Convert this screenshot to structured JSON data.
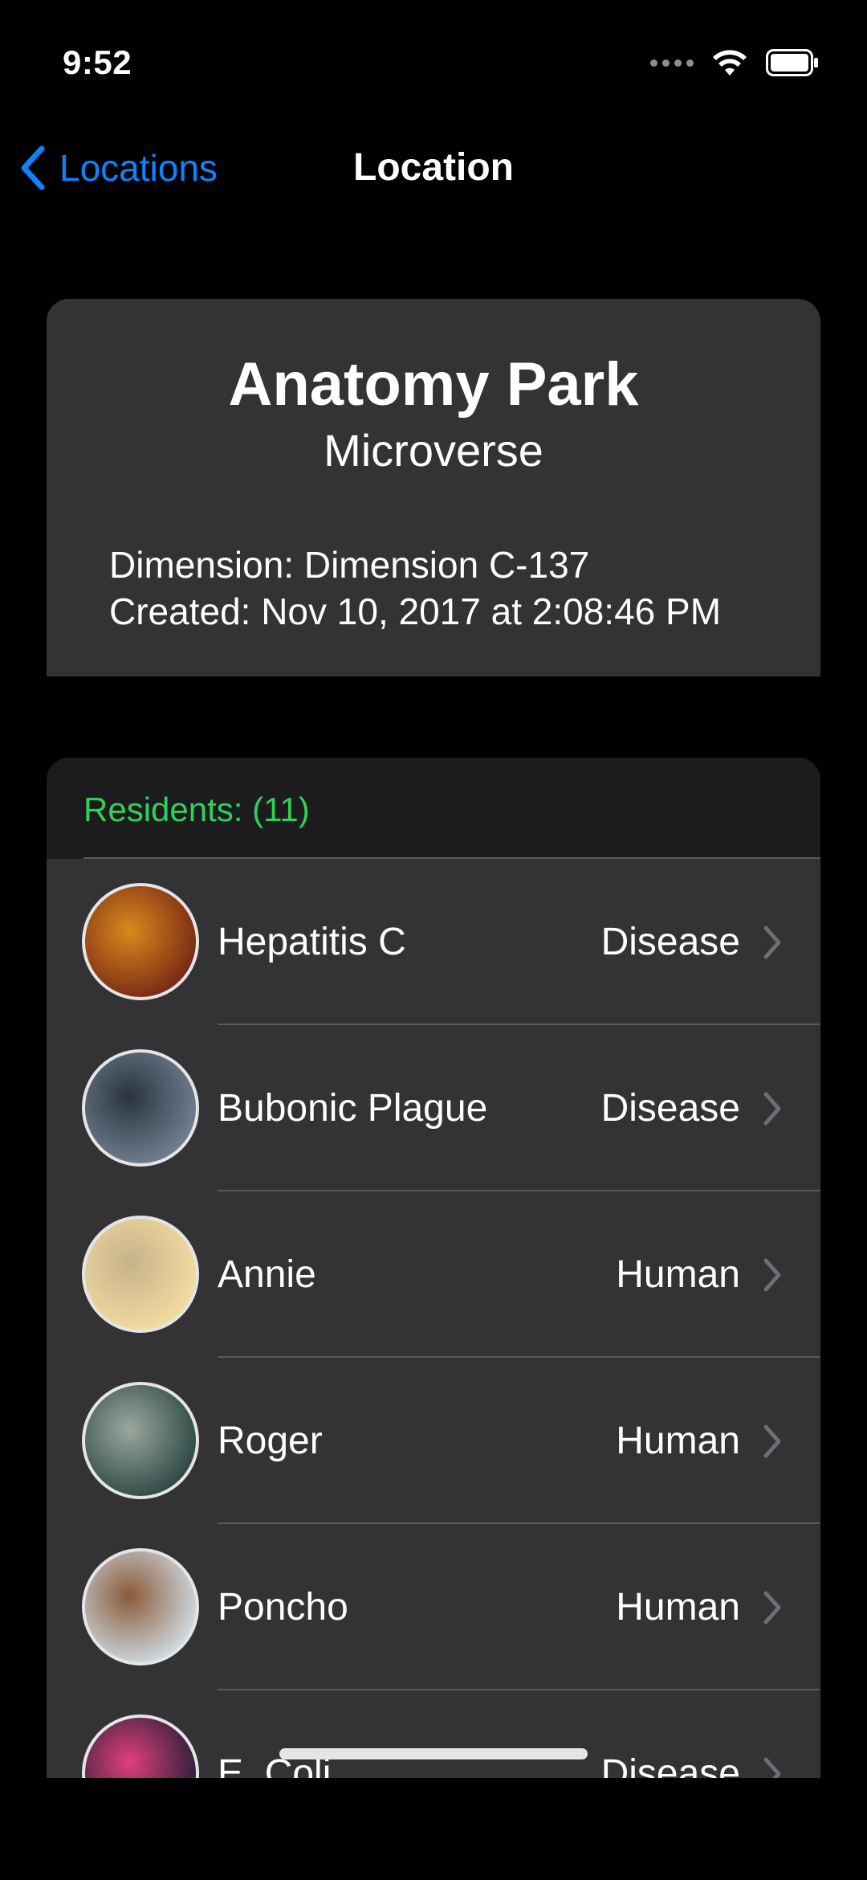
{
  "status_bar": {
    "time": "9:52"
  },
  "nav": {
    "back_label": "Locations",
    "title": "Location"
  },
  "location": {
    "name": "Anatomy Park",
    "type": "Microverse",
    "dimension": "Dimension: Dimension C-137",
    "created": "Created: Nov 10, 2017 at 2:08:46 PM"
  },
  "residents": {
    "header": "Residents: (11)",
    "items": [
      {
        "name": "Hepatitis C",
        "species": "Disease",
        "avatar_colors": [
          "#7a2a14",
          "#d98a1c"
        ]
      },
      {
        "name": "Bubonic Plague",
        "species": "Disease",
        "avatar_colors": [
          "#6f7f8f",
          "#2b3440"
        ]
      },
      {
        "name": "Annie",
        "species": "Human",
        "avatar_colors": [
          "#f2dca0",
          "#c7b18a"
        ]
      },
      {
        "name": "Roger",
        "species": "Human",
        "avatar_colors": [
          "#2f4a45",
          "#9aa79f"
        ]
      },
      {
        "name": "Poncho",
        "species": "Human",
        "avatar_colors": [
          "#cfd9e0",
          "#8a5a3a"
        ]
      },
      {
        "name": "E. Coli",
        "species": "Disease",
        "avatar_colors": [
          "#2a1f3a",
          "#e0407a"
        ]
      }
    ]
  },
  "colors": {
    "accent": "#0a84ff",
    "residents_header": "#30d158",
    "card": "#333335"
  }
}
